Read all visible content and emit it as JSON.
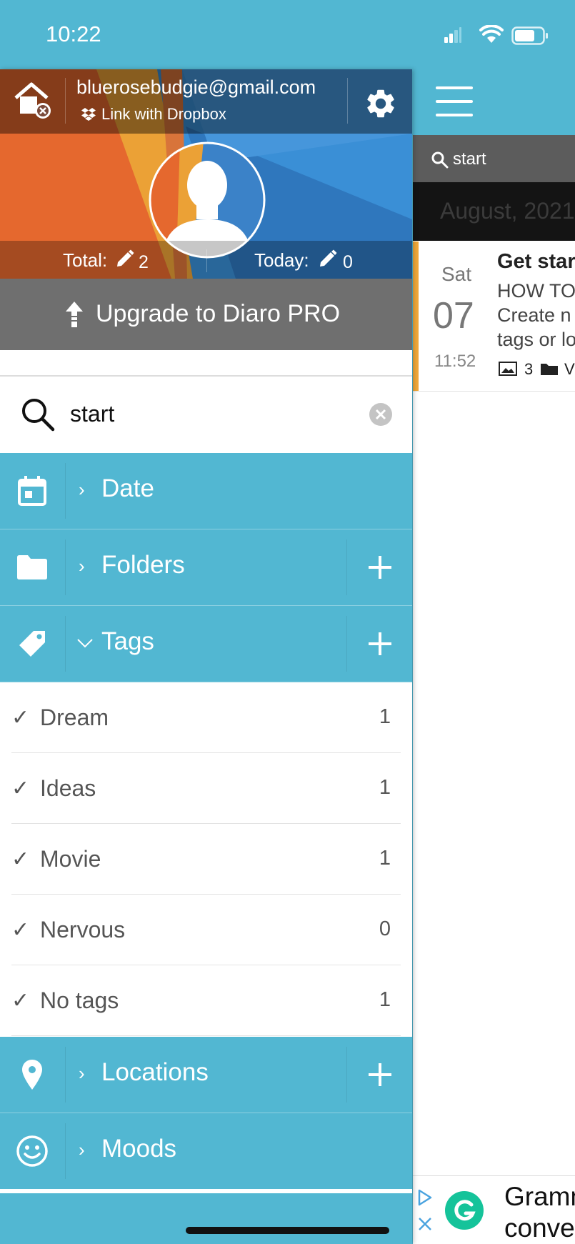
{
  "status_bar": {
    "time": "10:22"
  },
  "drawer": {
    "account": {
      "email": "bluerosebudgie@gmail.com",
      "dropbox_label": "Link with Dropbox"
    },
    "stats": {
      "total_label": "Total:",
      "total_value": "2",
      "today_label": "Today:",
      "today_value": "0"
    },
    "upgrade_label": "Upgrade to Diaro PRO",
    "search": {
      "value": "start"
    },
    "sections": {
      "date": "Date",
      "folders": "Folders",
      "tags": "Tags",
      "locations": "Locations",
      "moods": "Moods"
    },
    "tags": [
      {
        "name": "Dream",
        "count": "1"
      },
      {
        "name": "Ideas",
        "count": "1"
      },
      {
        "name": "Movie",
        "count": "1"
      },
      {
        "name": "Nervous",
        "count": "0"
      },
      {
        "name": "No tags",
        "count": "1"
      }
    ]
  },
  "main": {
    "search_value": "start",
    "month_label": "August, 2021",
    "entry": {
      "weekday": "Sat",
      "day": "07",
      "time": "11:52",
      "title": "Get star",
      "line1": "HOW TO",
      "line2": "Create n",
      "line3": "tags or lo",
      "photo_count": "3",
      "folder_label": "V"
    },
    "ad": {
      "line1": "Gramm",
      "line2": "conve"
    }
  },
  "colors": {
    "accent": "#52b7d2",
    "upgrade_bg": "#6f6f6f",
    "entry_stripe": "#f0a83a"
  }
}
